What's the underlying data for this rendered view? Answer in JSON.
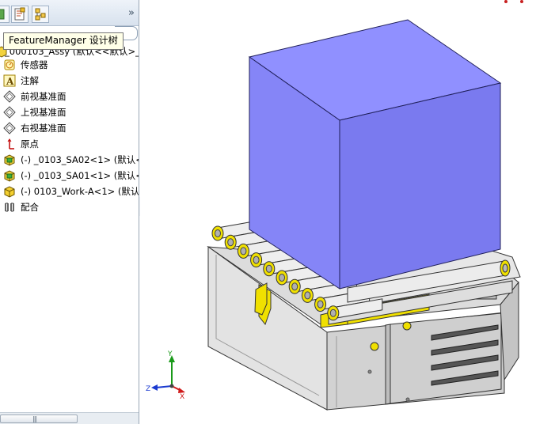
{
  "tooltip": {
    "text": "FeatureManager 设计树"
  },
  "tree": {
    "assembly": "_000103_Assy  (默认<<默认>_",
    "items": [
      {
        "label": "传感器",
        "icon": "sensor-icon"
      },
      {
        "label": "注解",
        "icon": "annotation-icon"
      },
      {
        "label": "前视基准面",
        "icon": "plane-icon"
      },
      {
        "label": "上视基准面",
        "icon": "plane-icon"
      },
      {
        "label": "右视基准面",
        "icon": "plane-icon"
      },
      {
        "label": "原点",
        "icon": "origin-icon"
      },
      {
        "label": "(-) _0103_SA02<1> (默认<",
        "icon": "subassembly-icon"
      },
      {
        "label": "(-) _0103_SA01<1> (默认<",
        "icon": "subassembly-icon"
      },
      {
        "label": "(-) 0103_Work-A<1> (默认",
        "icon": "part-icon"
      },
      {
        "label": "配合",
        "icon": "mates-icon"
      }
    ]
  },
  "scrollbar": {
    "grip": "|||"
  },
  "triad": {
    "x_label": "X",
    "y_label": "Y",
    "z_label": "Z"
  },
  "colors": {
    "block": "#7f7ff0",
    "accent": "#f0e000",
    "frame": "#d8d8d8"
  }
}
